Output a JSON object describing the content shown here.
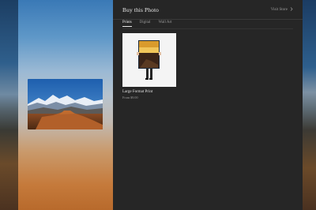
{
  "panel": {
    "title": "Buy this Photo",
    "visit_store_label": "Visit Store",
    "chevron_icon": "chevron-right-icon"
  },
  "tabs": [
    {
      "label": "Prints",
      "active": true
    },
    {
      "label": "Digital",
      "active": false
    },
    {
      "label": "Wall Art",
      "active": false
    }
  ],
  "products": [
    {
      "name": "Large Format Print",
      "price": "From $9.00"
    }
  ],
  "colors": {
    "panel_bg": "#262626",
    "text_primary": "#e6e6e6",
    "text_muted": "#9a9a9a"
  }
}
